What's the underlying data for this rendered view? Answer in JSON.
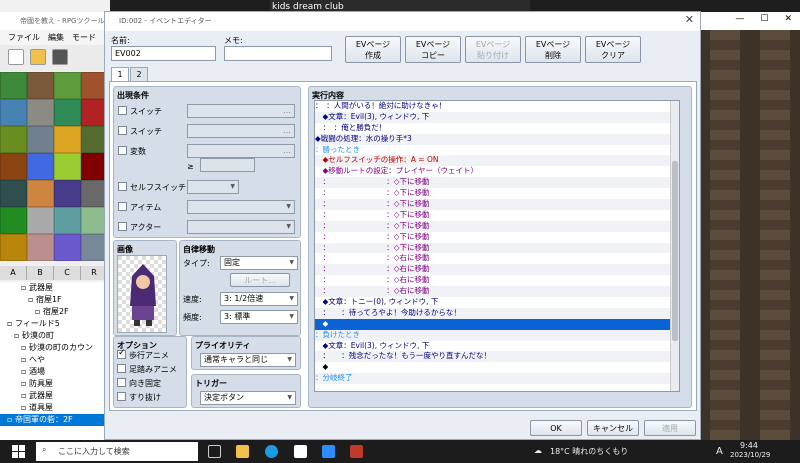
{
  "meeting": {
    "name": "kids dream club"
  },
  "app": {
    "title": "帝國を教え - RPGツクールMZ",
    "menu": [
      "ファイル",
      "編集",
      "モード"
    ]
  },
  "tile_tabs": [
    "A",
    "B",
    "C",
    "R"
  ],
  "tree": [
    {
      "label": "武器屋",
      "indent": 3
    },
    {
      "label": "宿屋1F",
      "indent": 4
    },
    {
      "label": "宿屋2F",
      "indent": 5
    },
    {
      "label": "フィールド5",
      "indent": 1
    },
    {
      "label": "砂漠の町",
      "indent": 2
    },
    {
      "label": "砂漠の町のカウン",
      "indent": 3
    },
    {
      "label": "へや",
      "indent": 3
    },
    {
      "label": "酒場",
      "indent": 3
    },
    {
      "label": "防具屋",
      "indent": 3
    },
    {
      "label": "武器屋",
      "indent": 3
    },
    {
      "label": "道具屋",
      "indent": 3
    },
    {
      "label": "帝国軍の砦：2F",
      "indent": 1,
      "selected": true
    }
  ],
  "dialog": {
    "title": "ID:002 - イベントエディター",
    "name_label": "名前:",
    "name_value": "EV002",
    "memo_label": "メモ:",
    "memo_value": "",
    "buttons": [
      "EVページ\n作成",
      "EVページ\nコピー",
      "EVページ\n貼り付け",
      "EVページ\n削除",
      "EVページ\nクリア"
    ],
    "tabs": [
      "1",
      "2"
    ],
    "conditions": {
      "title": "出現条件",
      "items": [
        "スイッチ",
        "スイッチ",
        "変数",
        "",
        "セルフスイッチ",
        "アイテム",
        "アクター"
      ],
      "ge": "≥"
    },
    "image": {
      "title": "画像"
    },
    "autonomous": {
      "title": "自律移動",
      "type_label": "タイプ:",
      "type_value": "固定",
      "route_label": "ルート...",
      "speed_label": "速度:",
      "speed_value": "3: 1/2倍速",
      "freq_label": "頻度:",
      "freq_value": "3: 標準"
    },
    "options": {
      "title": "オプション",
      "items": [
        {
          "label": "歩行アニメ",
          "checked": true
        },
        {
          "label": "足踏みアニメ",
          "checked": false
        },
        {
          "label": "向き固定",
          "checked": false
        },
        {
          "label": "すり抜け",
          "checked": false
        }
      ]
    },
    "priority": {
      "title": "プライオリティ",
      "value": "通常キャラと同じ"
    },
    "trigger": {
      "title": "トリガー",
      "value": "決定ボタン"
    },
    "exec": {
      "title": "実行内容",
      "rows": [
        {
          "t": "：　：人間がいる！絶対に助けなきゃ！",
          "c": "#000080"
        },
        {
          "t": "　◆文章：Evil(3), ウィンドウ, 下",
          "c": "#000080"
        },
        {
          "t": "　：　：俺と勝負だ！",
          "c": "#000080"
        },
        {
          "t": "◆戦闘の処理：水の操り手*3",
          "c": "#000080"
        },
        {
          "t": "：勝ったとき",
          "c": "#1e90ff"
        },
        {
          "t": "　◆セルフスイッチの操作：A = ON",
          "c": "#c00000"
        },
        {
          "t": "　◆移動ルートの設定：プレイヤー（ウェイト）",
          "c": "#800080"
        },
        {
          "t": "　：　　　　　　　　：◇下に移動",
          "c": "#800080"
        },
        {
          "t": "　：　　　　　　　　：◇下に移動",
          "c": "#800080"
        },
        {
          "t": "　：　　　　　　　　：◇下に移動",
          "c": "#800080"
        },
        {
          "t": "　：　　　　　　　　：◇下に移動",
          "c": "#800080"
        },
        {
          "t": "　：　　　　　　　　：◇下に移動",
          "c": "#800080"
        },
        {
          "t": "　：　　　　　　　　：◇下に移動",
          "c": "#800080"
        },
        {
          "t": "　：　　　　　　　　：◇下に移動",
          "c": "#800080"
        },
        {
          "t": "　：　　　　　　　　：◇右に移動",
          "c": "#800080"
        },
        {
          "t": "　：　　　　　　　　：◇右に移動",
          "c": "#800080"
        },
        {
          "t": "　：　　　　　　　　：◇右に移動",
          "c": "#800080"
        },
        {
          "t": "　：　　　　　　　　：◇右に移動",
          "c": "#800080"
        },
        {
          "t": "　◆文章：トニー(0), ウィンドウ, 下",
          "c": "#000080"
        },
        {
          "t": "　：　　：待ってろやよ！今助けるからな！",
          "c": "#000080"
        },
        {
          "t": "　◆",
          "c": "#fff",
          "sel": true
        },
        {
          "t": "：負けたとき",
          "c": "#1e90ff"
        },
        {
          "t": "　◆文章：Evil(3), ウィンドウ, 下",
          "c": "#000080"
        },
        {
          "t": "　：　　：残念だったな！もう一度やり直すんだな！",
          "c": "#000080"
        },
        {
          "t": "　◆",
          "c": "#000"
        },
        {
          "t": "：分岐終了",
          "c": "#1e90ff"
        }
      ]
    },
    "ok": "OK",
    "cancel": "キャンセル",
    "apply": "適用"
  },
  "taskbar": {
    "search_placeholder": "ここに入力して検索",
    "weather": "18°C 晴れのちくもり",
    "time": "9:44",
    "date": "2023/10/29",
    "ime": "A"
  },
  "colors": {
    "accent": "#0078d7",
    "exec_select": "#0a64d6"
  }
}
